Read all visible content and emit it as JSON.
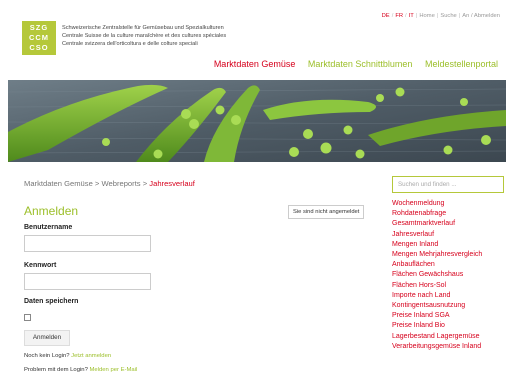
{
  "logo": {
    "line1": "SZG",
    "line2": "CCM",
    "line3": "CSO"
  },
  "org_names": [
    "Schweizerische Zentralstelle für Gemüsebau und Spezialkulturen",
    "Centrale Suisse de la culture maraîchère et des cultures spéciales",
    "Centrale svizzera dell'orticoltura e delle colture speciali"
  ],
  "topnav": {
    "lang_de": "DE",
    "lang_fr": "FR",
    "lang_it": "IT",
    "home": "Home",
    "suche": "Suche",
    "an_abmelden": "An / Abmelden"
  },
  "mainnav": {
    "gemuese": "Marktdaten Gemüse",
    "schnittblumen": "Marktdaten Schnittblumen",
    "meldestellen": "Meldestellenportal"
  },
  "breadcrumb": {
    "a": "Marktdaten Gemüse",
    "sep": ">",
    "b": "Webreports",
    "c": "Jahresverlauf"
  },
  "login": {
    "heading": "Anmelden",
    "status": "Sie sind nicht angemeldet",
    "username_label": "Benutzername",
    "password_label": "Kennwort",
    "remember_label": "Daten speichern",
    "button": "Anmelden",
    "no_login_text": "Noch kein Login?",
    "no_login_link": "Jetzt anmelden",
    "problem_text": "Problem mit dem Login?",
    "problem_link": "Melden per E-Mail"
  },
  "search": {
    "placeholder": "Suchen und finden ..."
  },
  "sidebar_links": [
    "Wochenmeldung",
    "Rohdatenabfrage",
    "Gesamtmarktverlauf",
    "Jahresverlauf",
    "Mengen Inland",
    "Mengen Mehrjahresvergleich",
    "Anbauflächen",
    "Flächen Gewächshaus",
    "Flächen Hors-Sol",
    "Importe nach Land",
    "Kontingentsausnutzung",
    "Preise Inland SGA",
    "Preise Inland Bio",
    "Lagerbestand Lagergemüse",
    "Verarbeitungsgemüse Inland"
  ],
  "colors": {
    "accent_green": "#9cbf2a",
    "link_red": "#d6001c",
    "logo_green": "#b5c83a"
  }
}
